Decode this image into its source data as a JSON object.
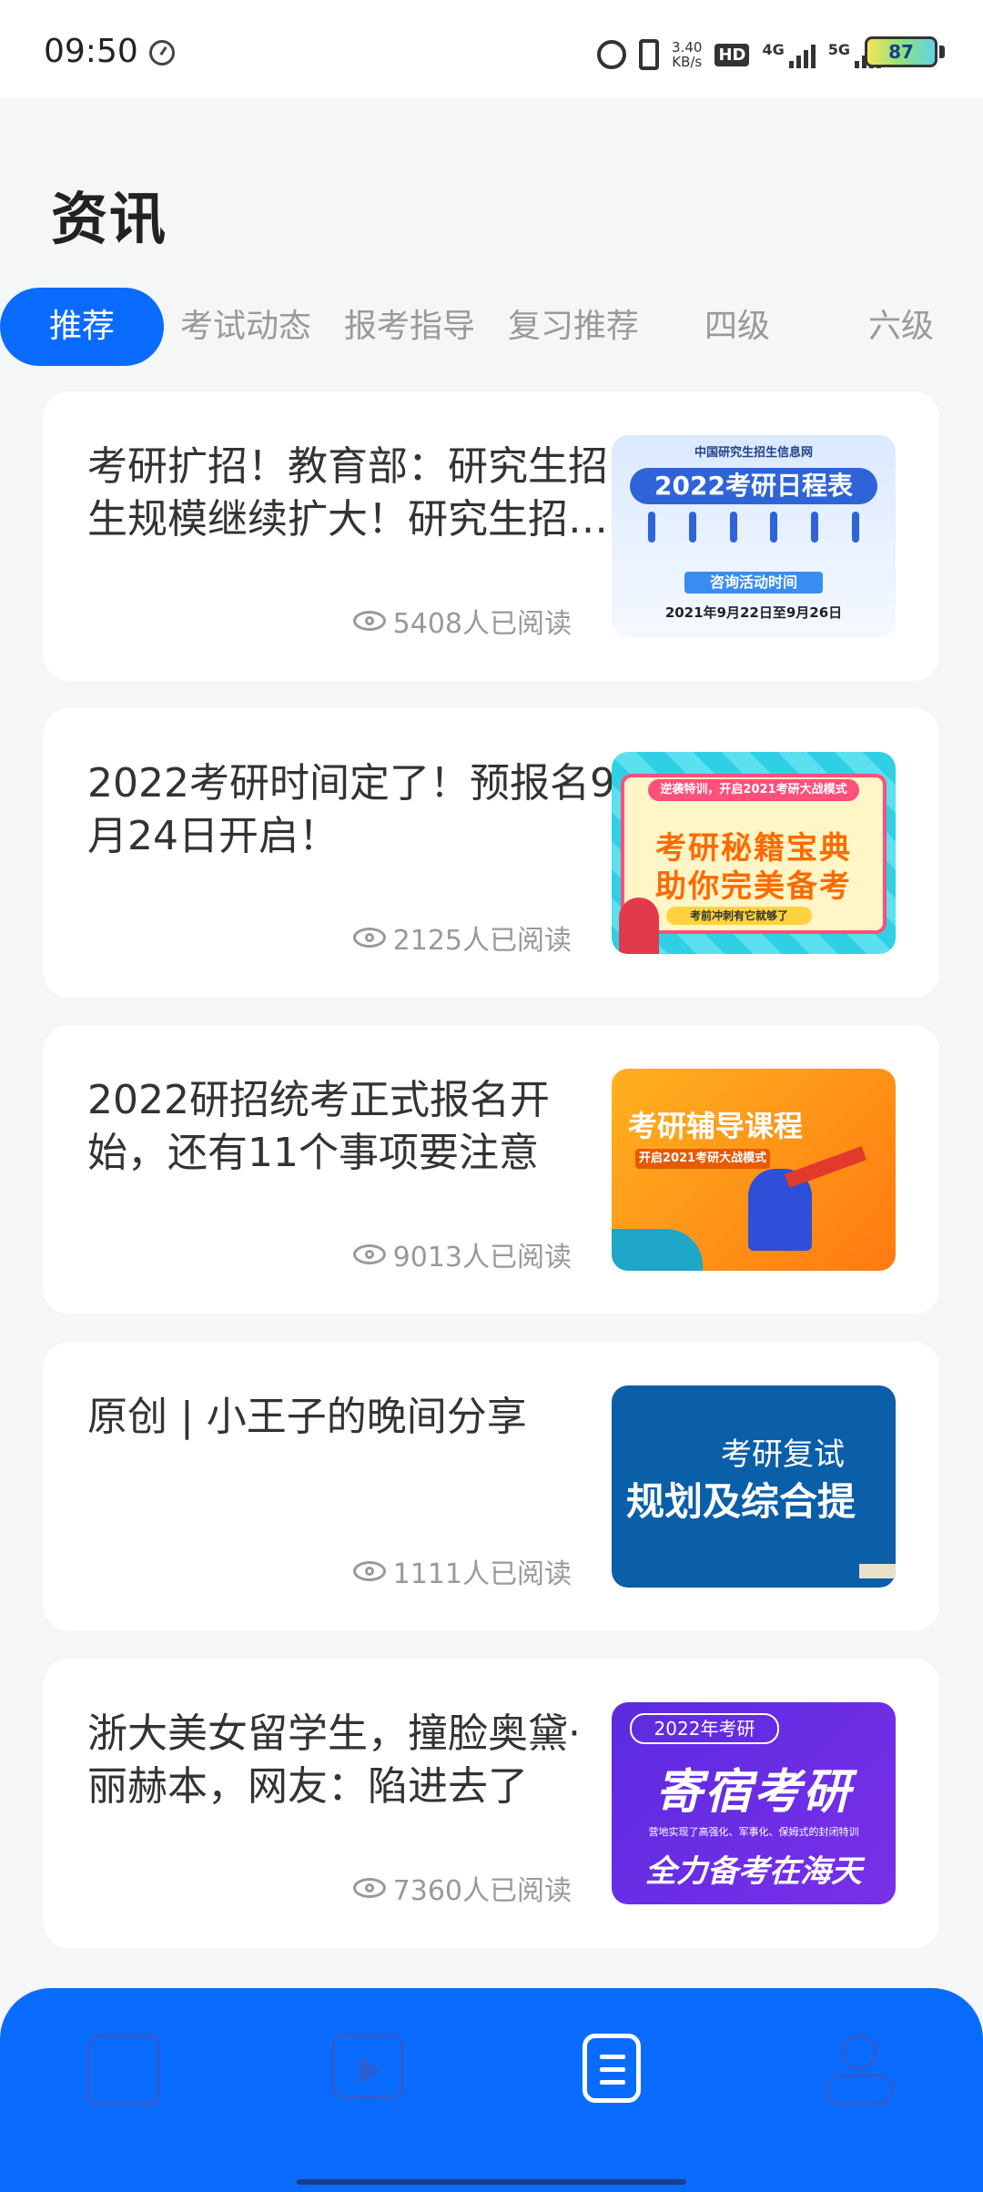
{
  "status_bar": {
    "time": "09:50",
    "net_speed_value": "3.40",
    "net_speed_unit": "KB/s",
    "hd_label": "HD",
    "net1": "4G",
    "net2": "5G",
    "battery": "87"
  },
  "header": {
    "title": "资讯"
  },
  "tabs": [
    {
      "label": "推荐",
      "active": true
    },
    {
      "label": "考试动态",
      "active": false
    },
    {
      "label": "报考指导",
      "active": false
    },
    {
      "label": "复习推荐",
      "active": false
    },
    {
      "label": "四级",
      "active": false
    },
    {
      "label": "六级",
      "active": false
    }
  ],
  "articles": [
    {
      "title": "考研扩招！教育部：研究生招生规模继续扩大！研究生招生规模继续扩大",
      "reads": "5408人已阅读",
      "thumb": {
        "line1": "中国研究生招生信息网",
        "line2": "2022考研日程表",
        "line3": "咨询活动时间",
        "line4": "2021年9月22日至9月26日"
      }
    },
    {
      "title": "2022考研时间定了！预报名9月24日开启！",
      "reads": "2125人已阅读",
      "thumb": {
        "line1": "逆袭特训，开启2021考研大战模式",
        "line2": "考研秘籍宝典",
        "line3": "助你完美备考",
        "line4": "考前冲刺有它就够了"
      }
    },
    {
      "title": "2022研招统考正式报名开始，还有11个事项要注意",
      "reads": "9013人已阅读",
      "thumb": {
        "line1": "考研辅导课程",
        "line2": "开启2021考研大战模式"
      }
    },
    {
      "title": "原创 | 小王子的晚间分享",
      "reads": "1111人已阅读",
      "thumb": {
        "line1": "考研复试",
        "line2": "规划及综合提"
      }
    },
    {
      "title": "浙大美女留学生，撞脸奥黛·丽赫本，网友：陷进去了",
      "reads": "7360人已阅读",
      "thumb": {
        "line1": "2022年考研",
        "line2": "寄宿考研",
        "line3": "营地实现了高强化、军事化、保姆式的封闭特训",
        "line4": "全力备考在海天"
      }
    }
  ],
  "colors": {
    "accent": "#0a6cff",
    "background": "#f5f6f8"
  },
  "bottom_nav": [
    {
      "icon": "home-icon",
      "active": false
    },
    {
      "icon": "video-icon",
      "active": false
    },
    {
      "icon": "news-icon",
      "active": true
    },
    {
      "icon": "user-icon",
      "active": false
    }
  ]
}
